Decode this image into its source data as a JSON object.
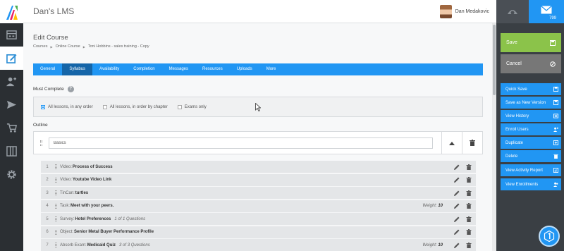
{
  "app": {
    "title": "Dan's LMS"
  },
  "user": {
    "name": "Dan Medakovic"
  },
  "messages": {
    "count": "799"
  },
  "page": {
    "title": "Edit Course",
    "breadcrumb": [
      "Courses",
      "Online Course",
      "Toni Hobbins - sales training - Copy"
    ]
  },
  "tabs": [
    {
      "label": "General",
      "active": false
    },
    {
      "label": "Syllabus",
      "active": true
    },
    {
      "label": "Availability",
      "active": false
    },
    {
      "label": "Completion",
      "active": false
    },
    {
      "label": "Messages",
      "active": false
    },
    {
      "label": "Resources",
      "active": false
    },
    {
      "label": "Uploads",
      "active": false
    },
    {
      "label": "More",
      "active": false
    }
  ],
  "must_complete": {
    "label": "Must Complete",
    "options": [
      {
        "label": "All lessons, in any order",
        "checked": true
      },
      {
        "label": "All lessons, in order by chapter",
        "checked": false
      },
      {
        "label": "Exams only",
        "checked": false
      }
    ]
  },
  "outline": {
    "label": "Outline",
    "chapter_name": "Basics",
    "items": [
      {
        "num": "1",
        "type": "Video:",
        "name": "Process of Success",
        "extra": "",
        "weight": ""
      },
      {
        "num": "2",
        "type": "Video:",
        "name": "Youtube Video Link",
        "extra": "",
        "weight": ""
      },
      {
        "num": "3",
        "type": "TinCan:",
        "name": "turtles",
        "extra": "",
        "weight": ""
      },
      {
        "num": "4",
        "type": "Task:",
        "name": "Meet with your peers.",
        "extra": "",
        "weight": "10"
      },
      {
        "num": "5",
        "type": "Survey:",
        "name": "Hotel Preferences",
        "extra": "1 of 1 Questions",
        "weight": ""
      },
      {
        "num": "6",
        "type": "Object:",
        "name": "Senior Metal Buyer Performance Profile",
        "extra": "",
        "weight": ""
      },
      {
        "num": "7",
        "type": "Absorb Exam:",
        "name": "Medicaid Quiz",
        "extra": "3 of 3 Questions",
        "weight": "10"
      }
    ],
    "weight_label": "Weight:"
  },
  "actions": {
    "save": "Save",
    "cancel": "Cancel",
    "side": [
      "Quick Save",
      "Save as New Version",
      "View History",
      "Enroll Users",
      "Duplicate",
      "Delete",
      "View Activity Report",
      "View Enrollments"
    ]
  },
  "colors": {
    "accent": "#2196f3",
    "save": "#8bc34a",
    "cancel": "#777777",
    "nav_bg": "#2b2f33",
    "panel_bg": "#3a3f44"
  }
}
